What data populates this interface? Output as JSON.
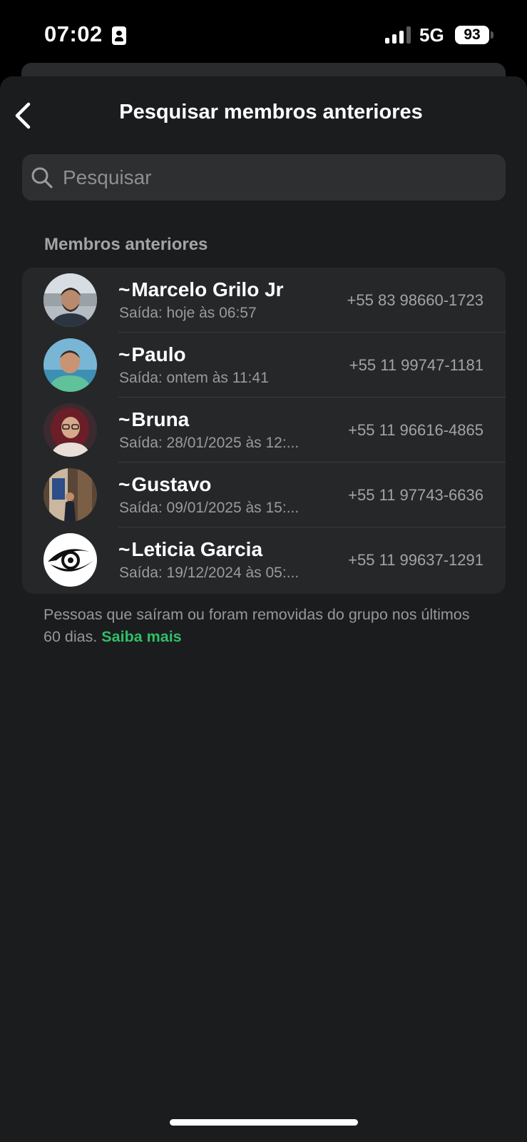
{
  "status_bar": {
    "time": "07:02",
    "network": "5G",
    "battery": "93",
    "icons": [
      "id-card-icon",
      "signal-icon",
      "battery-icon"
    ]
  },
  "header": {
    "title": "Pesquisar membros anteriores",
    "back_icon": "chevron-left-icon"
  },
  "search": {
    "placeholder": "Pesquisar",
    "value": "",
    "icon": "search-icon"
  },
  "section": {
    "title": "Membros anteriores"
  },
  "members": [
    {
      "prefix": "~",
      "name": "Marcelo Grilo Jr",
      "exit": "Saída: hoje às 06:57",
      "phone": "+55 83 98660-1723"
    },
    {
      "prefix": "~",
      "name": "Paulo",
      "exit": "Saída: ontem às 11:41",
      "phone": "+55 11 99747-1181"
    },
    {
      "prefix": "~",
      "name": "Bruna",
      "exit": "Saída: 28/01/2025 às 12:...",
      "phone": "+55 11 96616-4865"
    },
    {
      "prefix": "~",
      "name": "Gustavo",
      "exit": "Saída: 09/01/2025 às 15:...",
      "phone": "+55 11 97743-6636"
    },
    {
      "prefix": "~",
      "name": "Leticia Garcia",
      "exit": "Saída: 19/12/2024 às 05:...",
      "phone": "+55 11 99637-1291"
    }
  ],
  "footer": {
    "text": "Pessoas que saíram ou foram removidas do grupo nos últimos 60 dias.",
    "link": "Saiba mais"
  },
  "colors": {
    "background": "#1b1c1d",
    "card": "#262728",
    "accent_link": "#2fbf68",
    "secondary_text": "#9a9a9f"
  }
}
